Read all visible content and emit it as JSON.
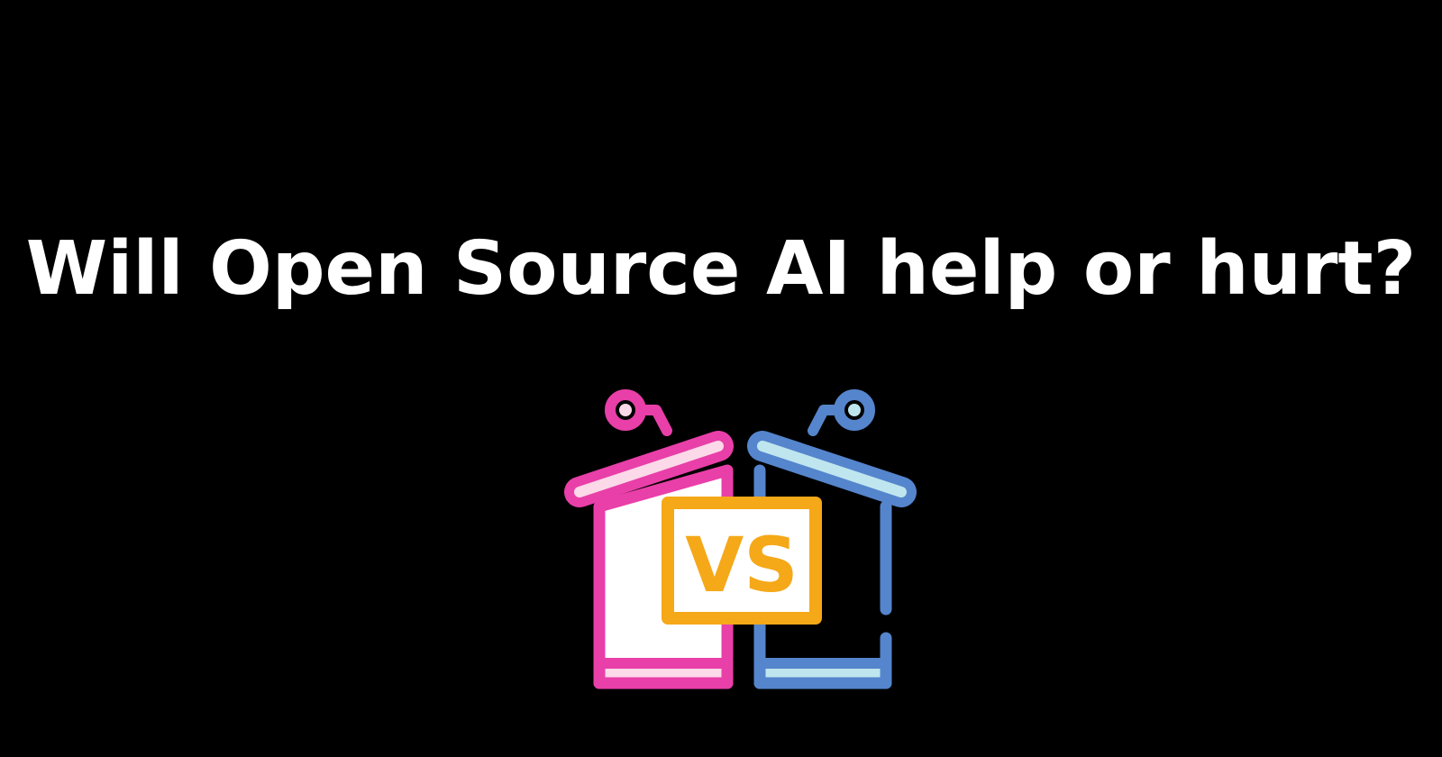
{
  "headline": "Will Open Source AI help or hurt?",
  "illustration": {
    "icon": "debate-podiums-vs-icon",
    "badge_text": "VS",
    "colors": {
      "background": "#000000",
      "headline": "#ffffff",
      "left_podium": "#e93fa8",
      "left_podium_light": "#fbd9e8",
      "right_podium": "#5585cc",
      "right_podium_light": "#bfe6ef",
      "vs_badge": "#f5a818"
    }
  }
}
